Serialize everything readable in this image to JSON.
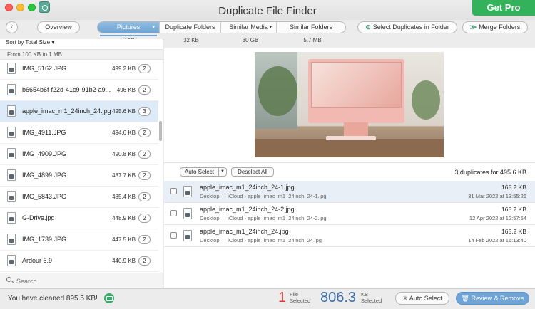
{
  "window": {
    "title": "Duplicate File Finder",
    "get_pro": "Get Pro"
  },
  "toolbar": {
    "back_icon": "chevron-left-icon",
    "overview": "Overview",
    "tabs": [
      {
        "label": "Pictures",
        "size": "57 MB",
        "active": true
      },
      {
        "label": "Duplicate Folders",
        "size": "32 KB",
        "active": false
      },
      {
        "label": "Similar Media",
        "size": "30 GB",
        "active": false
      },
      {
        "label": "Similar Folders",
        "size": "5.7 MB",
        "active": false
      }
    ],
    "select_duplicates": "Select Duplicates in Folder",
    "merge_folders": "Merge Folders"
  },
  "sidebar": {
    "sort_label": "Sort by Total Size",
    "range_label": "From 100 KB to 1 MB",
    "files": [
      {
        "name": "IMG_5162.JPG",
        "size": "499.2 KB",
        "count": "2"
      },
      {
        "name": "b6654b6f-f22d-41c9-91b2-a9...",
        "size": "496 KB",
        "count": "2"
      },
      {
        "name": "apple_imac_m1_24inch_24.jpg",
        "size": "495.6 KB",
        "count": "3"
      },
      {
        "name": "IMG_4911.JPG",
        "size": "494.6 KB",
        "count": "2"
      },
      {
        "name": "IMG_4909.JPG",
        "size": "490.8 KB",
        "count": "2"
      },
      {
        "name": "IMG_4899.JPG",
        "size": "487.7 KB",
        "count": "2"
      },
      {
        "name": "IMG_5843.JPG",
        "size": "485.4 KB",
        "count": "2"
      },
      {
        "name": "G-Drive.jpg",
        "size": "448.9 KB",
        "count": "2"
      },
      {
        "name": "IMG_1739.JPG",
        "size": "447.5 KB",
        "count": "2"
      },
      {
        "name": "Ardour 6.9",
        "size": "440.9 KB",
        "count": "2"
      }
    ],
    "search_placeholder": "Search"
  },
  "duplicates": {
    "auto_select": "Auto Select",
    "deselect_all": "Deselect All",
    "summary": "3 duplicates for 495.6 KB",
    "items": [
      {
        "name": "apple_imac_m1_24inch_24-1.jpg",
        "path": "Desktop — iCloud › apple_imac_m1_24inch_24-1.jpg",
        "size": "165.2 KB",
        "date": "31 Mar 2022 at 13:55:26"
      },
      {
        "name": "apple_imac_m1_24inch_24-2.jpg",
        "path": "Desktop — iCloud › apple_imac_m1_24inch_24-2.jpg",
        "size": "165.2 KB",
        "date": "12 Apr 2022 at 12:57:54"
      },
      {
        "name": "apple_imac_m1_24inch_24.jpg",
        "path": "Desktop — iCloud › apple_imac_m1_24inch_24.jpg",
        "size": "165.2 KB",
        "date": "14 Feb 2022 at 16:13:40"
      }
    ]
  },
  "footer": {
    "cleaned": "You have cleaned 895.5 KB!",
    "files_count": "1",
    "files_label_1": "File",
    "files_label_2": "Selected",
    "kb_count": "806.3",
    "kb_label_1": "KB",
    "kb_label_2": "Selected",
    "auto_select": "Auto Select",
    "review_remove": "Review & Remove"
  }
}
